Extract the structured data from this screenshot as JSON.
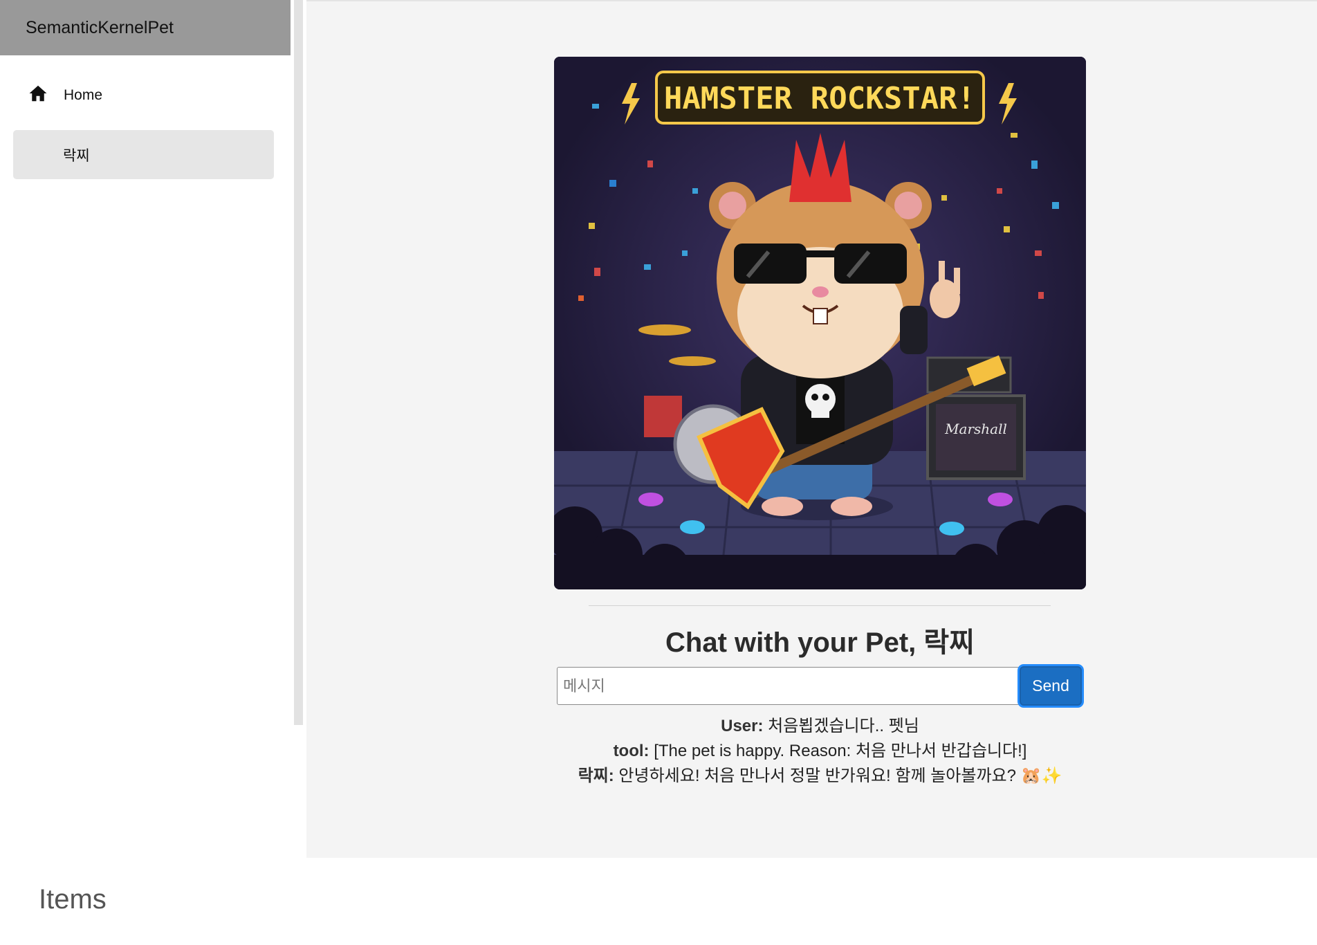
{
  "sidebar": {
    "brand": "SemanticKernelPet",
    "nav": {
      "home_label": "Home",
      "pet_label": "락찌"
    }
  },
  "image": {
    "banner_text": "HAMSTER ROCKSTAR!",
    "amp_brand": "Marshall",
    "alt": "Hamster rockstar pixel art"
  },
  "chat": {
    "title": "Chat with your Pet, 락찌",
    "input_placeholder": "메시지",
    "input_value": "",
    "send_label": "Send",
    "messages": [
      {
        "speaker": "User:",
        "text": "처음뵙겠습니다.. 펫님"
      },
      {
        "speaker": "tool:",
        "text": "[The pet is happy. Reason: 처음 만나서 반갑습니다!]"
      },
      {
        "speaker": "락찌:",
        "text": "안녕하세요! 처음 만나서 정말 반가워요! 함께 놀아볼까요? 🐹✨"
      }
    ]
  },
  "items": {
    "heading": "Items"
  },
  "colors": {
    "brand_bar": "#999999",
    "active_nav": "#e6e6e6",
    "main_bg": "#f4f4f4",
    "send_button": "#1b6ec2"
  }
}
